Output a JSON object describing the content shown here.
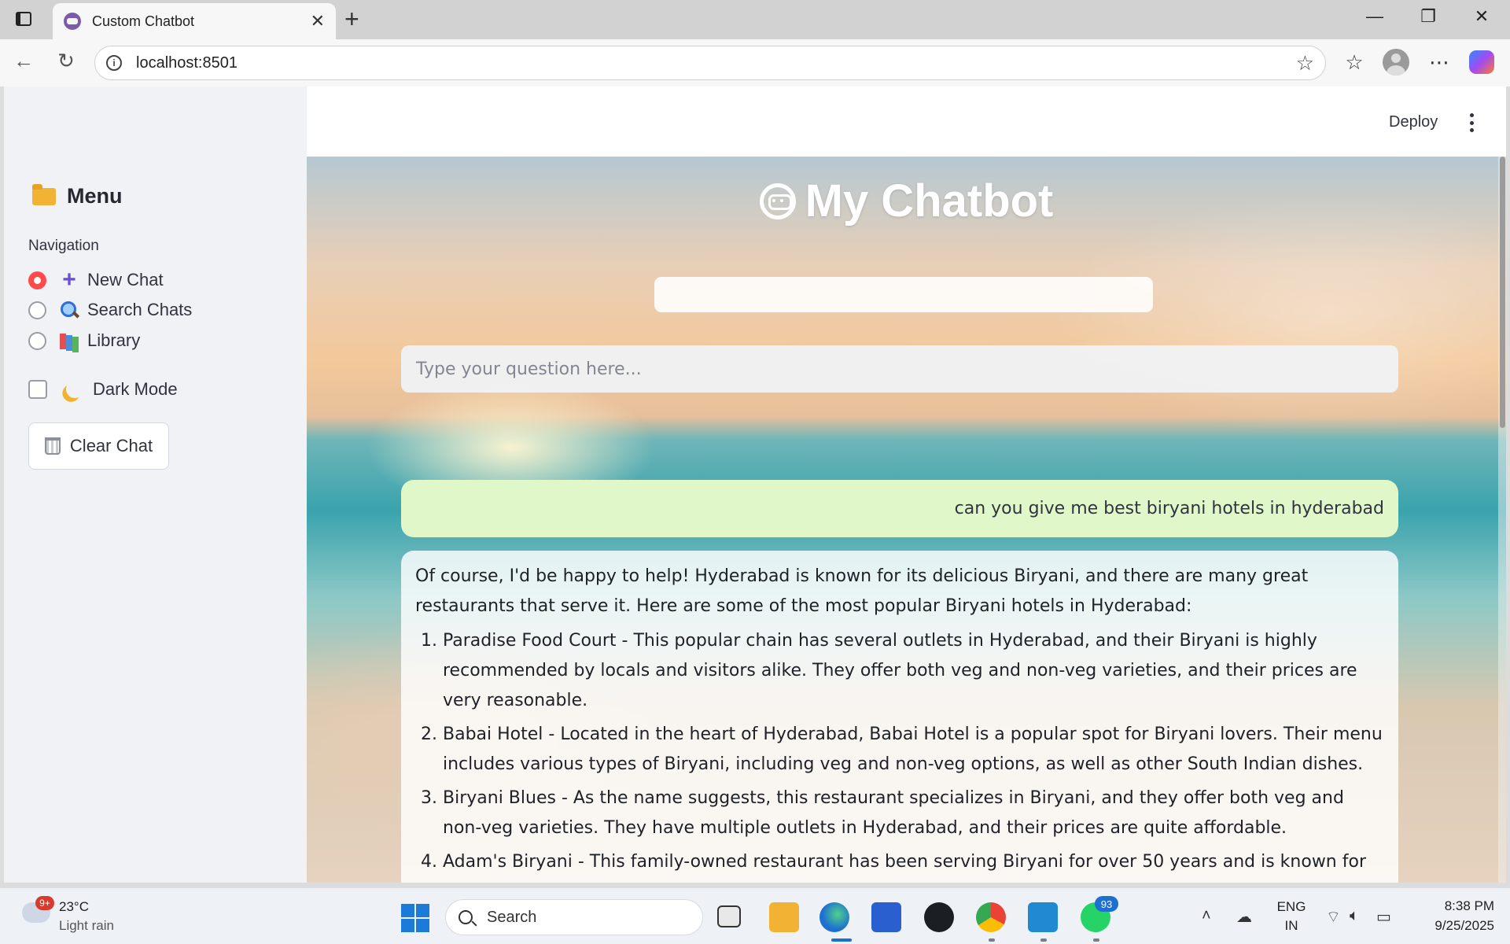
{
  "browser": {
    "tab_title": "Custom Chatbot",
    "url": "localhost:8501"
  },
  "sidebar": {
    "title": "Menu",
    "nav_label": "Navigation",
    "nav_options": [
      {
        "label": "New Chat",
        "icon": "plus-icon",
        "selected": true
      },
      {
        "label": "Search Chats",
        "icon": "magnifier-icon",
        "selected": false
      },
      {
        "label": "Library",
        "icon": "books-icon",
        "selected": false
      }
    ],
    "dark_mode_label": "Dark Mode",
    "dark_mode_checked": false,
    "clear_button": "Clear Chat"
  },
  "header": {
    "deploy": "Deploy"
  },
  "chat": {
    "title": "My Chatbot",
    "question_placeholder": "Type your question here...",
    "user_message": "can you give me best biryani hotels in hyderabad",
    "bot_intro": "Of course, I'd be happy to help! Hyderabad is known for its delicious Biryani, and there are many great restaurants that serve it. Here are some of the most popular Biryani hotels in Hyderabad:",
    "bot_list": [
      "Paradise Food Court - This popular chain has several outlets in Hyderabad, and their Biryani is highly recommended by locals and visitors alike. They offer both veg and non-veg varieties, and their prices are very reasonable.",
      "Babai Hotel - Located in the heart of Hyderabad, Babai Hotel is a popular spot for Biryani lovers. Their menu includes various types of Biryani, including veg and non-veg options, as well as other South Indian dishes.",
      "Biryani Blues - As the name suggests, this restaurant specializes in Biryani, and they offer both veg and non-veg varieties. They have multiple outlets in Hyderabad, and their prices are quite affordable.",
      "Adam's Biryani - This family-owned restaurant has been serving Biryani for over 50 years and is known for its authentic taste and quality ingredients. They offer both veg and non-veg options, and their prices are reasonable."
    ]
  },
  "taskbar": {
    "weather_badge": "9+",
    "temperature": "23°C",
    "condition": "Light rain",
    "search": "Search",
    "whatsapp_badge": "93",
    "lang_top": "ENG",
    "lang_bottom": "IN",
    "time": "8:38 PM",
    "date": "9/25/2025"
  },
  "colors": {
    "accent_red": "#ff4b4b",
    "user_bubble": "#dff7c9",
    "sidebar_bg": "#f0f2f6"
  }
}
